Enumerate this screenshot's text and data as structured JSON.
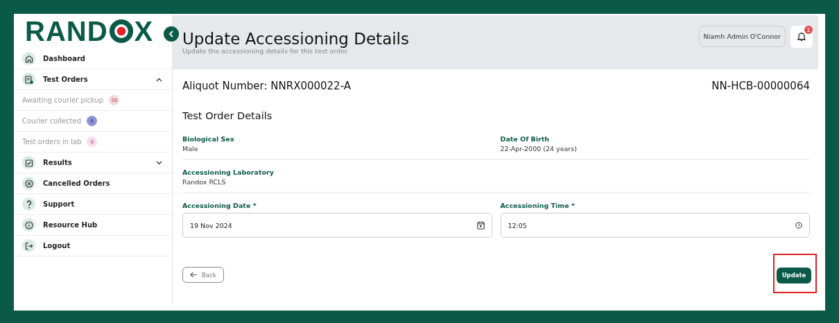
{
  "logo": {
    "before": "RAND",
    "after": "X"
  },
  "sidebar": {
    "items": [
      {
        "label": "Dashboard",
        "kind": "main"
      },
      {
        "label": "Test Orders",
        "kind": "group",
        "expanded": true
      },
      {
        "label": "Awaiting courier pickup",
        "kind": "sub",
        "count": "38",
        "color": "#f7d9d9"
      },
      {
        "label": "Courier collected",
        "kind": "sub",
        "count": "6",
        "color": "#8e92d8"
      },
      {
        "label": "Test orders in lab",
        "kind": "sub",
        "count": "6",
        "color": "#f6def0"
      },
      {
        "label": "Results",
        "kind": "group",
        "expanded": false
      },
      {
        "label": "Cancelled Orders",
        "kind": "main"
      },
      {
        "label": "Support",
        "kind": "main"
      },
      {
        "label": "Resource Hub",
        "kind": "main"
      },
      {
        "label": "Logout",
        "kind": "main"
      }
    ]
  },
  "header": {
    "title": "Update Accessioning Details",
    "subtitle": "Update the accessioning details for this test order.",
    "user": "Niamh Admin O'Connor",
    "notifications": "1"
  },
  "order": {
    "aliquot": "Aliquot Number: NNRX000022-A",
    "reference": "NN-HCB-00000064",
    "section": "Test Order Details",
    "rows": [
      [
        {
          "label": "Biological Sex",
          "value": "Male"
        },
        {
          "label": "Date Of Birth",
          "value": "22-Apr-2000 (24 years)"
        }
      ],
      [
        {
          "label": "Accessioning Laboratory",
          "value": "Randox RCLS"
        }
      ]
    ],
    "inputs": [
      {
        "label": "Accessioning Date *",
        "value": "19 Nov 2024",
        "kind": "date"
      },
      {
        "label": "Accessioning Time *",
        "value": "12:05",
        "kind": "time"
      }
    ]
  },
  "buttons": {
    "back": "Back",
    "update": "Update",
    "update_highlighted": true
  }
}
